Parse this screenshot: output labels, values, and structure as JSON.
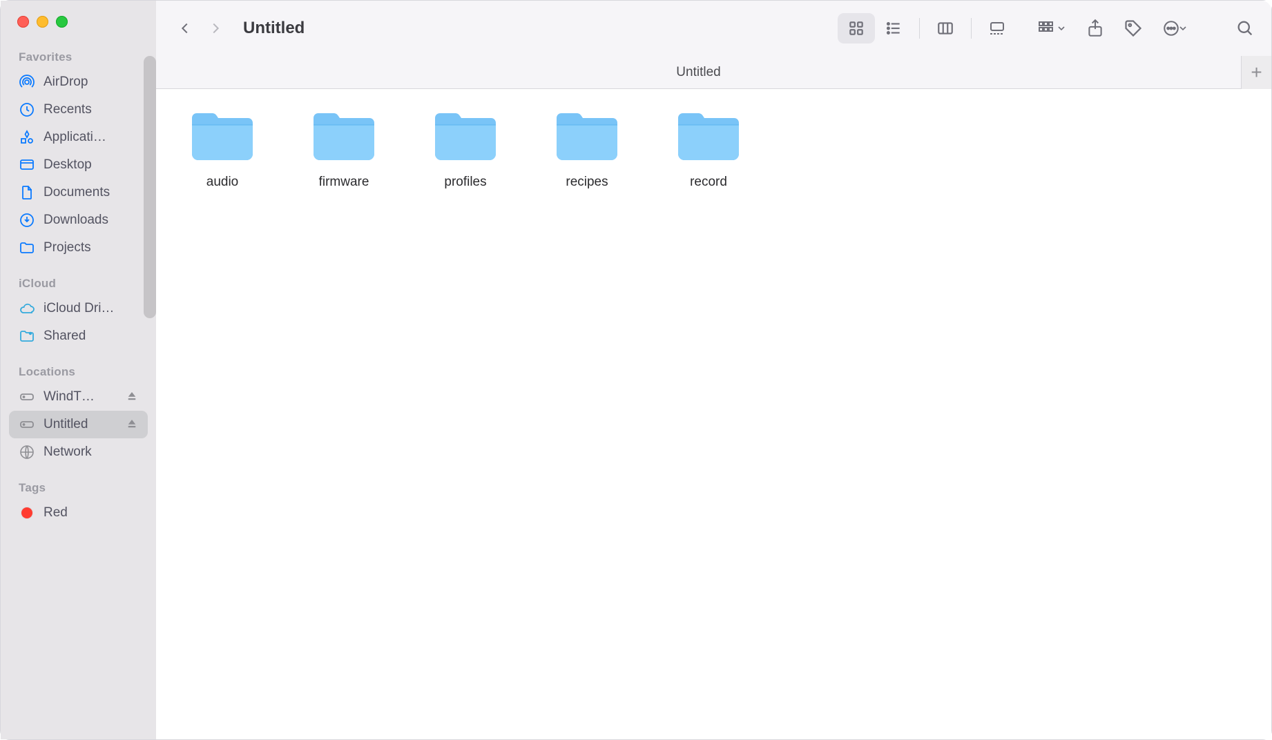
{
  "window": {
    "title": "Untitled",
    "path_title": "Untitled"
  },
  "traffic": {
    "close": "close",
    "minimize": "minimize",
    "zoom": "zoom"
  },
  "sidebar": {
    "favorites_heading": "Favorites",
    "favorites": [
      {
        "label": "AirDrop",
        "icon": "airdrop"
      },
      {
        "label": "Recents",
        "icon": "clock"
      },
      {
        "label": "Applicati…",
        "icon": "apps"
      },
      {
        "label": "Desktop",
        "icon": "desktop"
      },
      {
        "label": "Documents",
        "icon": "document"
      },
      {
        "label": "Downloads",
        "icon": "download"
      },
      {
        "label": "Projects",
        "icon": "folder"
      }
    ],
    "icloud_heading": "iCloud",
    "icloud": [
      {
        "label": "iCloud Dri…",
        "icon": "cloud"
      },
      {
        "label": "Shared",
        "icon": "shared-folder"
      }
    ],
    "locations_heading": "Locations",
    "locations": [
      {
        "label": "WindT…",
        "icon": "disk",
        "eject": true,
        "selected": false
      },
      {
        "label": "Untitled",
        "icon": "disk",
        "eject": true,
        "selected": true
      },
      {
        "label": "Network",
        "icon": "globe",
        "eject": false,
        "selected": false
      }
    ],
    "tags_heading": "Tags",
    "tags": [
      {
        "label": "Red",
        "color": "red"
      }
    ]
  },
  "toolbar": {
    "back": "Back",
    "forward": "Forward",
    "view_icons": "Icon view",
    "view_list": "List view",
    "view_columns": "Column view",
    "view_gallery": "Gallery view",
    "group": "Group",
    "share": "Share",
    "tag": "Edit tags",
    "more": "More",
    "search": "Search",
    "add": "+"
  },
  "folders": [
    {
      "name": "audio"
    },
    {
      "name": "firmware"
    },
    {
      "name": "profiles"
    },
    {
      "name": "recipes"
    },
    {
      "name": "record"
    }
  ]
}
